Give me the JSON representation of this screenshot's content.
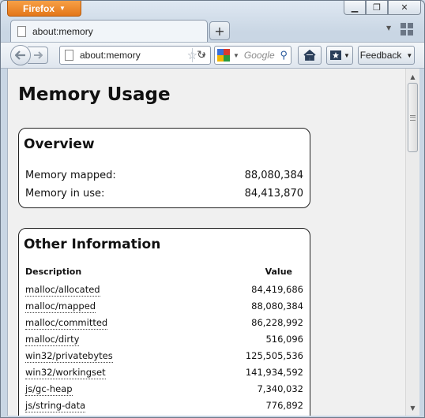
{
  "browser": {
    "menu_button_label": "Firefox",
    "tab_title": "about:memory",
    "url": "about:memory",
    "search_placeholder": "Google",
    "feedback_label": "Feedback"
  },
  "icons": {
    "back": "back-arrow-icon",
    "forward": "forward-arrow-icon",
    "home": "home-icon",
    "bookmarks": "bookmarks-icon",
    "star": "star-icon",
    "reload": "reload-icon",
    "search": "magnifier-icon"
  },
  "page": {
    "title": "Memory Usage",
    "overview": {
      "heading": "Overview",
      "rows": [
        {
          "label": "Memory mapped:",
          "value": "88,080,384"
        },
        {
          "label": "Memory in use:",
          "value": "84,413,870"
        }
      ]
    },
    "other": {
      "heading": "Other Information",
      "col_description": "Description",
      "col_value": "Value",
      "rows": [
        {
          "key": "malloc/allocated",
          "value": "84,419,686"
        },
        {
          "key": "malloc/mapped",
          "value": "88,080,384"
        },
        {
          "key": "malloc/committed",
          "value": "86,228,992"
        },
        {
          "key": "malloc/dirty",
          "value": "516,096"
        },
        {
          "key": "win32/privatebytes",
          "value": "125,505,536"
        },
        {
          "key": "win32/workingset",
          "value": "141,934,592"
        },
        {
          "key": "js/gc-heap",
          "value": "7,340,032"
        },
        {
          "key": "js/string-data",
          "value": "776,892"
        }
      ]
    }
  },
  "colors": {
    "firefox_orange": "#e3771a",
    "page_background": "#f0f0f0"
  }
}
